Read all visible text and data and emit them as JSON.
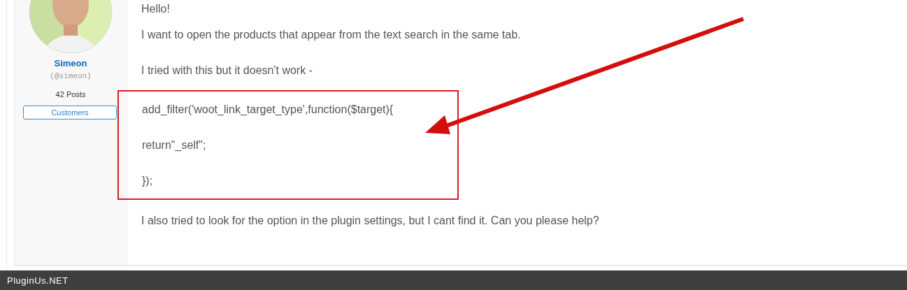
{
  "author": {
    "name": "Simeon",
    "handle": "(@simeon)",
    "posts": "42 Posts",
    "role": "Customers"
  },
  "post": {
    "intro": [
      "Hello!",
      "I want to open the products that appear from the text search in the same tab.",
      "I tried with this but it doesn't work -"
    ],
    "code": [
      "add_filter('woot_link_target_type',function($target){",
      "return\"_self\";",
      "});"
    ],
    "outro": [
      "I also tried to look for the option in the plugin settings, but I cant find it. Can you please help?"
    ]
  },
  "footer": {
    "site": "PluginUs.NET"
  }
}
